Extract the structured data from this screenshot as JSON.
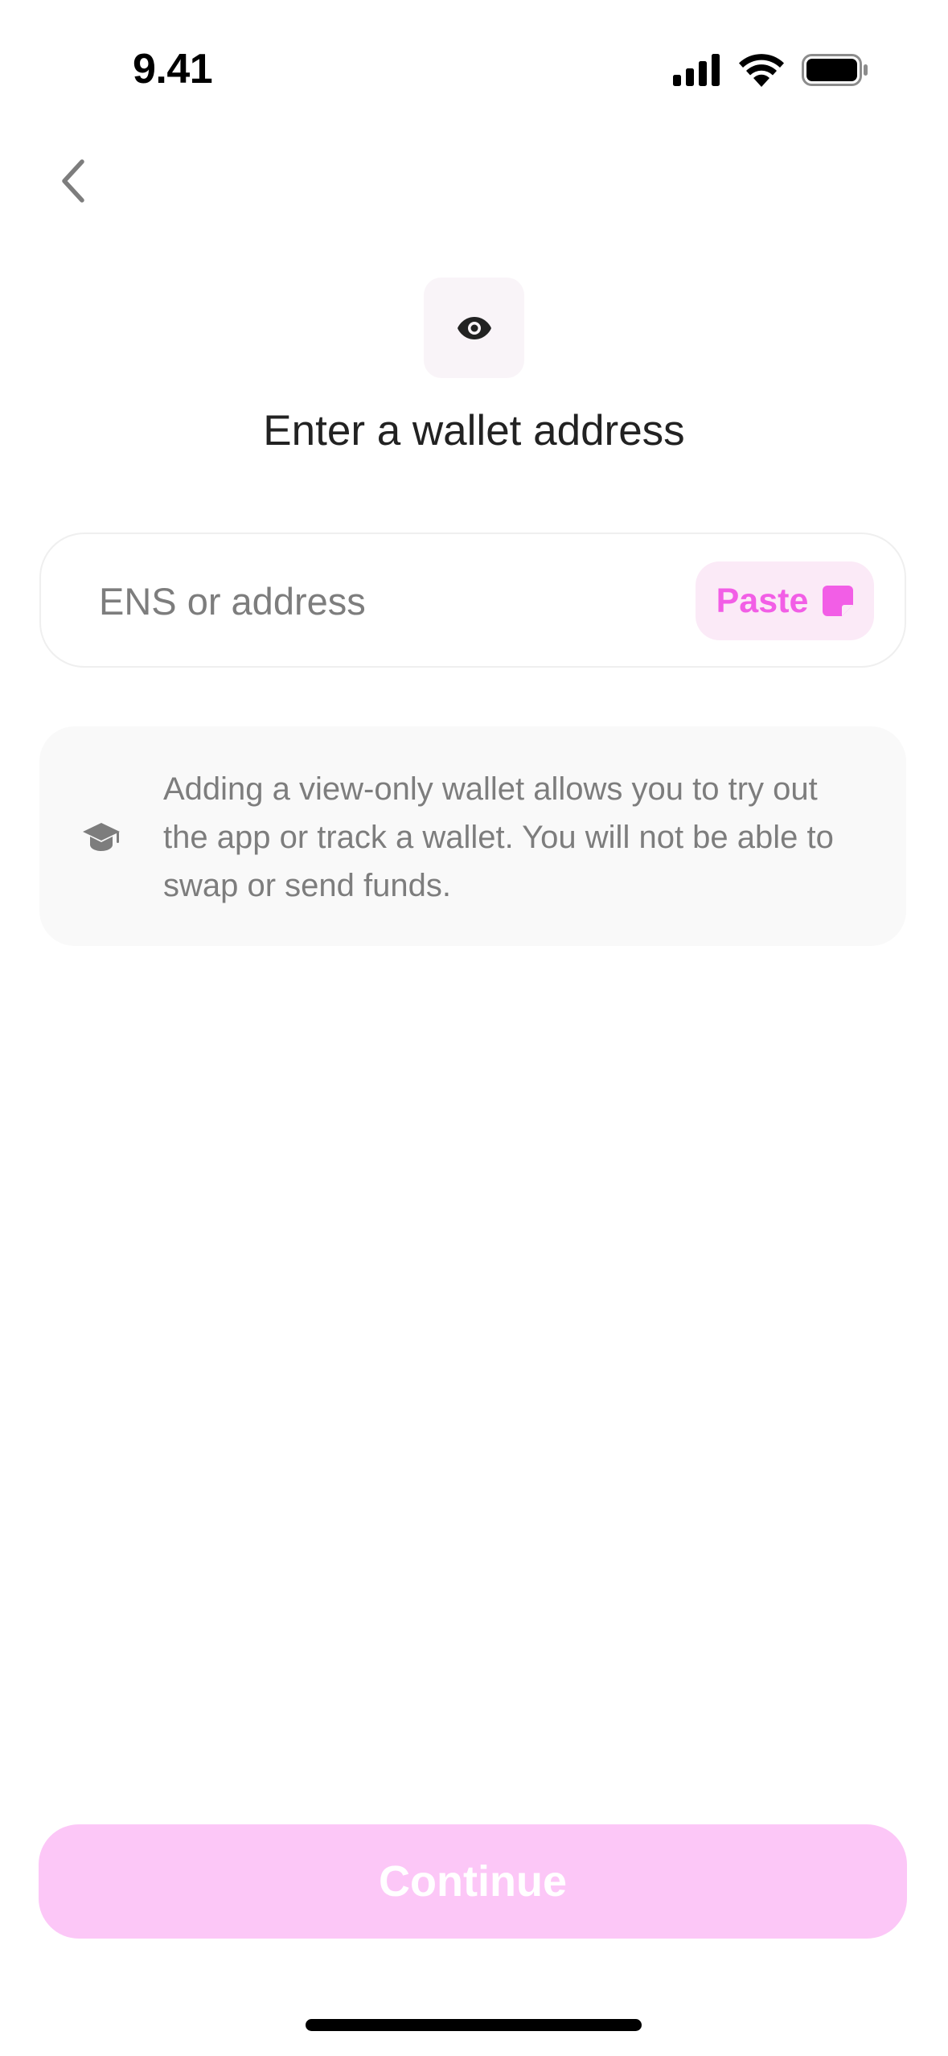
{
  "status_bar": {
    "time": "9.41"
  },
  "header": {
    "title": "Enter a wallet address"
  },
  "address_field": {
    "value": "",
    "placeholder": "ENS or address",
    "paste_label": "Paste"
  },
  "info": {
    "text": "Adding a view-only wallet allows you to try out the app or track a wallet. You will not be able to swap or send funds."
  },
  "footer": {
    "continue_label": "Continue"
  },
  "icons": {
    "back": "chevron-left-icon",
    "eye": "eye-icon",
    "paste": "clipboard-icon",
    "info": "graduation-cap-icon"
  },
  "colors": {
    "accent": "#F25EE6",
    "accent_soft": "#FCC7F7",
    "paste_bg": "#FBEAF7",
    "tile_bg": "#F9F4F8",
    "info_bg": "#F9F9F9",
    "text_primary": "#222222",
    "text_secondary": "#7D7D7D"
  }
}
